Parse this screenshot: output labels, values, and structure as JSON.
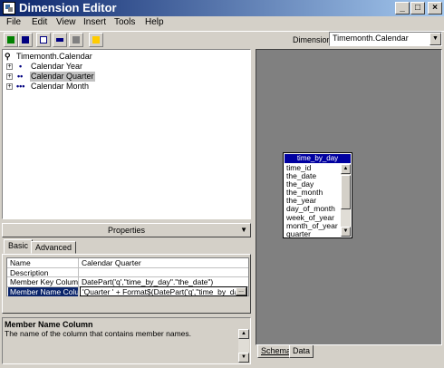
{
  "window": {
    "title": "Dimension Editor"
  },
  "title_buttons": {
    "minimize": "_",
    "maximize": "□",
    "close": "×"
  },
  "menu": [
    "File",
    "Edit",
    "View",
    "Insert",
    "Tools",
    "Help"
  ],
  "toolbar": {
    "icons": [
      "edit-icon",
      "save-icon",
      "view-icon",
      "schema-icon",
      "properties-icon",
      "process-icon"
    ],
    "dimension_label": "Dimension:",
    "dimension_value": "Timemonth.Calendar"
  },
  "tree": {
    "root": "Timemonth.Calendar",
    "levels": [
      {
        "dots": "•",
        "label": "Calendar Year"
      },
      {
        "dots": "••",
        "label": "Calendar Quarter",
        "selected": true
      },
      {
        "dots": "•••",
        "label": "Calendar Month"
      }
    ]
  },
  "properties": {
    "header": "Properties",
    "tabs": [
      "Basic",
      "Advanced"
    ],
    "active_tab": "Basic",
    "rows": [
      {
        "name": "Name",
        "value": "Calendar Quarter"
      },
      {
        "name": "Description",
        "value": ""
      },
      {
        "name": "Member Key Column",
        "value": "DatePart('q',\"time_by_day\".\"the_date\")"
      },
      {
        "name": "Member Name Column",
        "value": "'Quarter ' + Format$(DatePart('q',\"time_by_day\".\"the_",
        "selected": true
      }
    ],
    "ellipsis": "..."
  },
  "description": {
    "title": "Member Name Column",
    "text": "The name of the column that contains member names."
  },
  "schema": {
    "table_name": "time_by_day",
    "columns": [
      "time_id",
      "the_date",
      "the_day",
      "the_month",
      "the_year",
      "day_of_month",
      "week_of_year",
      "month_of_year",
      "quarter"
    ],
    "tabs": [
      "Schema",
      "Data"
    ],
    "active_tab": "Schema"
  },
  "colors": {
    "title_start": "#0a246a",
    "title_end": "#a6caf0",
    "selection": "#0a246a",
    "table_header": "#0000a0"
  }
}
